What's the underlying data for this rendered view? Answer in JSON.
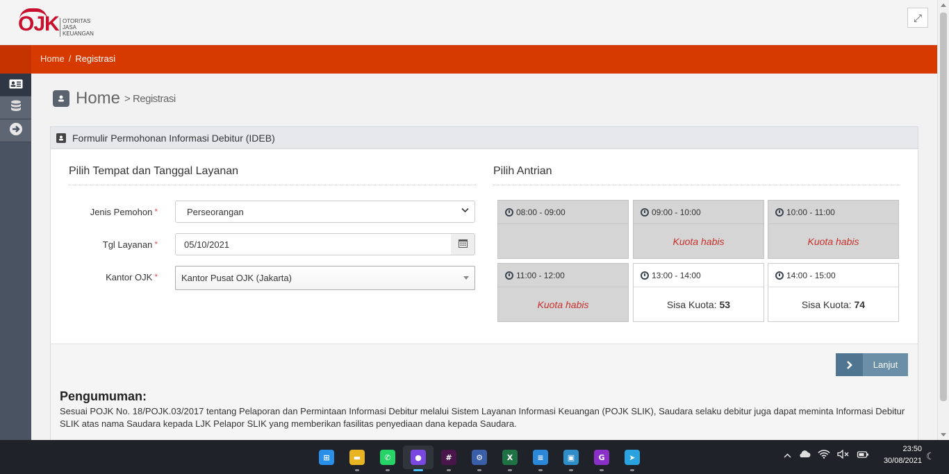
{
  "header": {
    "logo_main": "OJK",
    "logo_lines": [
      "OTORITAS",
      "JASA",
      "KEUANGAN"
    ],
    "fullscreen_icon": "expand-icon"
  },
  "breadcrumb": {
    "home": "Home",
    "separator": "/",
    "current": "Registrasi"
  },
  "sidebar": {
    "items": [
      {
        "icon": "id-card-icon",
        "active": true
      },
      {
        "icon": "database-icon",
        "active": false
      },
      {
        "icon": "arrow-right-circle-icon",
        "active": false
      }
    ]
  },
  "page": {
    "title_main": "Home",
    "title_sub": "> Registrasi"
  },
  "panel": {
    "heading": "Formulir Permohonan Informasi Debitur (IDEB)"
  },
  "form": {
    "section_title": "Pilih Tempat dan Tanggal Layanan",
    "required_mark": "*",
    "jenis_pemohon": {
      "label": "Jenis Pemohon",
      "value": "Perseorangan"
    },
    "tgl_layanan": {
      "label": "Tgl Layanan",
      "value": "05/10/2021"
    },
    "kantor_ojk": {
      "label": "Kantor OJK",
      "value": "Kantor Pusat OJK (Jakarta)"
    }
  },
  "queue": {
    "section_title": "Pilih Antrian",
    "quota_label": "Sisa Kuota:",
    "slots": [
      {
        "time": "08:00 - 09:00",
        "status": "empty",
        "text": ""
      },
      {
        "time": "09:00 - 10:00",
        "status": "full",
        "text": "Kuota habis"
      },
      {
        "time": "10:00 - 11:00",
        "status": "full",
        "text": "Kuota habis"
      },
      {
        "time": "11:00 - 12:00",
        "status": "full",
        "text": "Kuota habis"
      },
      {
        "time": "13:00 - 14:00",
        "status": "open",
        "text": "53"
      },
      {
        "time": "14:00 - 15:00",
        "status": "open",
        "text": "74"
      }
    ]
  },
  "actions": {
    "next_label": "Lanjut"
  },
  "announcement": {
    "title": "Pengumuman:",
    "body": "Sesuai POJK No. 18/POJK.03/2017 tentang Pelaporan dan Permintaan Informasi Debitur melalui Sistem Layanan Informasi Keuangan (POJK SLIK), Saudara selaku debitur juga dapat meminta Informasi Debitur SLIK atas nama Saudara kepada LJK Pelapor SLIK yang memberikan fasilitas penyediaan dana kepada Saudara."
  },
  "taskbar": {
    "apps": [
      {
        "name": "start-icon",
        "glyph": "⊞",
        "color": "#2a8fe8",
        "active": false
      },
      {
        "name": "file-explorer-icon",
        "glyph": "▬",
        "color": "#e8b422",
        "active": false
      },
      {
        "name": "whatsapp-icon",
        "glyph": "✆",
        "color": "#25d366",
        "active": false
      },
      {
        "name": "firefox-icon",
        "glyph": "●",
        "color": "#7a48e0",
        "active": true
      },
      {
        "name": "slack-icon",
        "glyph": "#",
        "color": "#4a154b",
        "active": false
      },
      {
        "name": "settings-icon",
        "glyph": "⚙",
        "color": "#3a5ea8",
        "active": false
      },
      {
        "name": "excel-icon",
        "glyph": "X",
        "color": "#1f7244",
        "active": false
      },
      {
        "name": "notepad-icon",
        "glyph": "≡",
        "color": "#2b88d8",
        "active": false
      },
      {
        "name": "remote-desktop-icon",
        "glyph": "▣",
        "color": "#2f8dc8",
        "active": false
      },
      {
        "name": "pdf-icon",
        "glyph": "G",
        "color": "#8b2fc9",
        "active": false
      },
      {
        "name": "telegram-icon",
        "glyph": "➤",
        "color": "#2aa3e0",
        "active": false
      }
    ],
    "time": "23:50",
    "date": "30/08/2021"
  }
}
